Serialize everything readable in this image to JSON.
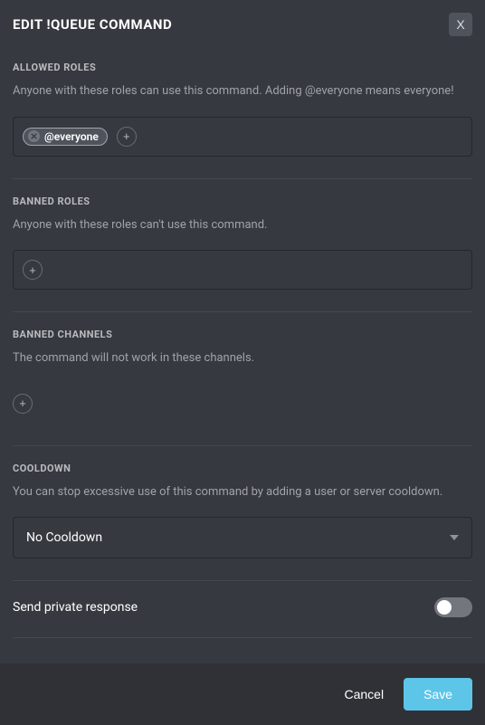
{
  "header": {
    "title": "EDIT !QUEUE COMMAND",
    "close": "X"
  },
  "sections": {
    "allowed_roles": {
      "title": "ALLOWED ROLES",
      "desc": "Anyone with these roles can use this command. Adding @everyone means everyone!",
      "chips": [
        {
          "label": "@everyone"
        }
      ]
    },
    "banned_roles": {
      "title": "BANNED ROLES",
      "desc": "Anyone with these roles can't use this command."
    },
    "banned_channels": {
      "title": "BANNED CHANNELS",
      "desc": "The command will not work in these channels."
    },
    "cooldown": {
      "title": "COOLDOWN",
      "desc": "You can stop excessive use of this command by adding a user or server cooldown.",
      "selected": "No Cooldown"
    },
    "private_response": {
      "label": "Send private response",
      "value": false
    }
  },
  "footer": {
    "cancel": "Cancel",
    "save": "Save"
  }
}
